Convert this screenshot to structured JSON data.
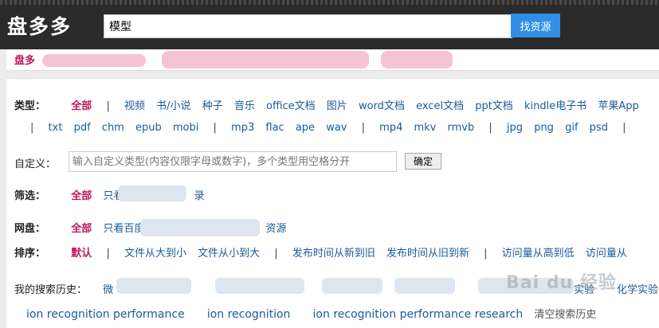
{
  "header": {
    "logo": "盘多多",
    "search_value": "模型",
    "search_button": "找资源"
  },
  "notice": {
    "text": "盘多"
  },
  "filters": {
    "type": {
      "label": "类型：",
      "row1": [
        "视频",
        "书/小说",
        "种子",
        "音乐",
        "office文档",
        "图片",
        "word文档",
        "excel文档",
        "ppt文档",
        "kindle电子书",
        "苹果App"
      ],
      "row2_group1": [
        "txt",
        "pdf",
        "chm",
        "epub",
        "mobi"
      ],
      "row2_group2": [
        "mp3",
        "flac",
        "ape",
        "wav"
      ],
      "row2_group3": [
        "mp4",
        "mkv",
        "rmvb"
      ],
      "row2_group4": [
        "jpg",
        "png",
        "gif",
        "psd"
      ]
    },
    "all": "全部",
    "separator": "|",
    "custom": {
      "label": "自定义：",
      "placeholder": "输入自定义类型(内容仅限字母或数字)，多个类型用空格分开",
      "confirm": "确定"
    },
    "screen": {
      "label": "筛选：",
      "only_prefix": "只看",
      "only_suffix": "录"
    },
    "disk": {
      "label": "网盘：",
      "only_prefix": "只看百度",
      "only_suffix": "资源"
    },
    "sort": {
      "label": "排序：",
      "default": "默认",
      "options": [
        "文件从大到小",
        "文件从小到大",
        "发布时间从新到旧",
        "发布时间从旧到新",
        "访问量从高到低",
        "访问量从"
      ]
    },
    "history": {
      "label": "我的搜索历史：",
      "items_row1": [
        "微",
        "实验",
        "化学实验"
      ],
      "items_row2": [
        "ion recognition performance",
        "ion recognition",
        "ion recognition performance research"
      ],
      "clear": "清空搜索历史"
    }
  },
  "watermark": "Bai du 经验"
}
